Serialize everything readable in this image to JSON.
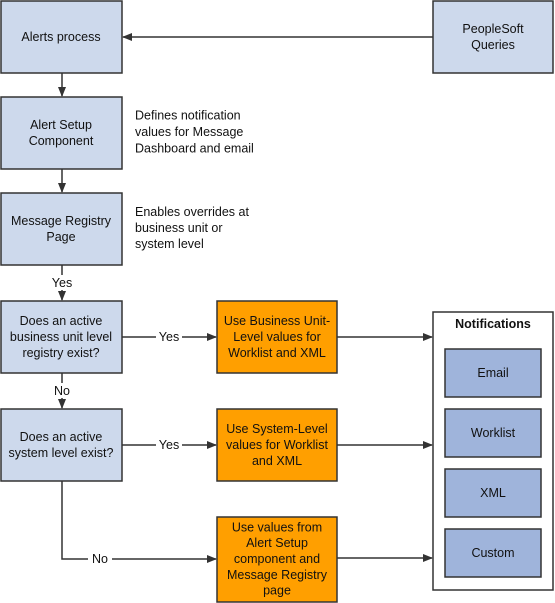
{
  "nodes": {
    "alerts_process": [
      "Alerts process"
    ],
    "peoplesoft_queries": [
      "PeopleSoft",
      "Queries"
    ],
    "alert_setup": [
      "Alert Setup",
      "Component"
    ],
    "message_registry": [
      "Message Registry",
      "Page"
    ],
    "decision_bu": [
      "Does an active",
      "business unit level",
      "registry exist?"
    ],
    "decision_system": [
      "Does an active",
      "system level exist?"
    ],
    "use_bu": [
      "Use Business Unit-",
      "Level values for",
      "Worklist and XML"
    ],
    "use_system": [
      "Use System-Level",
      "values for Worklist",
      "and XML"
    ],
    "use_setup": [
      "Use values from",
      "Alert Setup",
      "component and",
      "Message Registry",
      "page"
    ]
  },
  "annotations": {
    "alert_setup_note": [
      "Defines notification",
      "values for Message",
      "Dashboard and email"
    ],
    "message_registry_note": [
      "Enables overrides at",
      "business unit or",
      "system level"
    ]
  },
  "edge_labels": {
    "yes1": "Yes",
    "yes2": "Yes",
    "yes3": "Yes",
    "no1": "No",
    "no2": "No"
  },
  "notifications": {
    "title": "Notifications",
    "items": [
      "Email",
      "Worklist",
      "XML",
      "Custom"
    ]
  },
  "colors": {
    "process": "#cdd9ec",
    "action": "#ff9f00",
    "notification": "#9fb4db"
  }
}
